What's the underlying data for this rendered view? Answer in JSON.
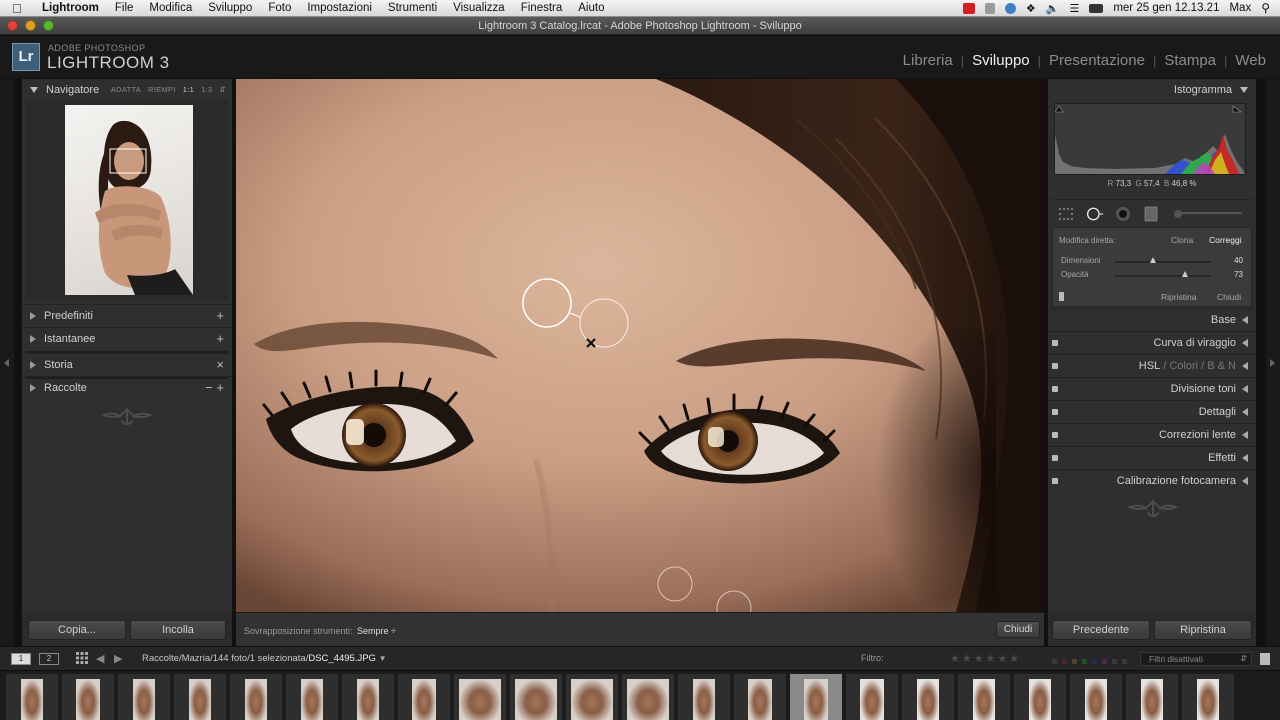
{
  "menubar": {
    "app": "Lightroom",
    "items": [
      "File",
      "Modifica",
      "Sviluppo",
      "Foto",
      "Impostazioni",
      "Strumenti",
      "Visualizza",
      "Finestra",
      "Aiuto"
    ],
    "clock": "mer 25 gen  12.13.21",
    "user": "Max"
  },
  "window": {
    "title": "Lightroom 3 Catalog.lrcat - Adobe Photoshop Lightroom - Sviluppo"
  },
  "identity": {
    "logo": "Lr",
    "brand_small": "ADOBE PHOTOSHOP",
    "brand_big": "LIGHTROOM 3"
  },
  "modules": {
    "items": [
      "Libreria",
      "Sviluppo",
      "Presentazione",
      "Stampa",
      "Web"
    ],
    "active": "Sviluppo"
  },
  "left_panel": {
    "navigator": {
      "title": "Navigatore",
      "options": [
        "ADATTA",
        "RIEMPI",
        "1:1",
        "1:3"
      ]
    },
    "sections": [
      {
        "label": "Predefiniti",
        "action": "+"
      },
      {
        "label": "Istantanee",
        "action": "+"
      },
      {
        "label": "Storia",
        "action": "×"
      },
      {
        "label": "Raccolte",
        "action": "− +"
      }
    ],
    "copy_label": "Copia...",
    "paste_label": "Incolla"
  },
  "toolbar": {
    "overlay_label": "Sovrapposizione strumenti:",
    "overlay_value": "Sempre ÷",
    "close_label": "Chiudi"
  },
  "right_panel": {
    "histogram": {
      "title": "Istogramma",
      "r_label": "R",
      "r_value": "73,3",
      "g_label": "G",
      "g_value": "57,4",
      "b_label": "B",
      "b_value": "46,8 %"
    },
    "spot": {
      "title": "Modifica diretta:",
      "clone": "Clona",
      "heal": "Correggi",
      "size_label": "Dimensioni",
      "size_value": "40",
      "size_level": 0.4,
      "opacity_label": "Opacità",
      "opacity_value": "73",
      "opacity_level": 0.73,
      "reset": "Ripristina",
      "close": "Chiudi"
    },
    "sections": [
      {
        "label": "Base",
        "switch": false
      },
      {
        "label": "Curva di viraggio",
        "switch": true
      },
      {
        "label": "HSL",
        "switch": true,
        "extra": [
          " / ",
          "Colori",
          " / ",
          "B & N"
        ]
      },
      {
        "label": "Divisione toni",
        "switch": true
      },
      {
        "label": "Dettagli",
        "switch": true
      },
      {
        "label": "Correzioni lente",
        "switch": true
      },
      {
        "label": "Effetti",
        "switch": true
      },
      {
        "label": "Calibrazione fotocamera",
        "switch": true
      }
    ],
    "prev_label": "Precedente",
    "reset_label": "Ripristina"
  },
  "filmstrip_bar": {
    "screen1": "1",
    "screen2": "2",
    "path": "Raccolte/Mazria/144 foto/1 selezionata/",
    "file": "DSC_4495.JPG",
    "filter_label": "Filtro:",
    "filter_select": "Filtri disattivati"
  },
  "filmstrip": {
    "count": 22,
    "selected_index": 14
  },
  "colors": {
    "panel": "#2f2f2f",
    "skin": "#c9a48c",
    "accent": "#d0d0d0"
  }
}
